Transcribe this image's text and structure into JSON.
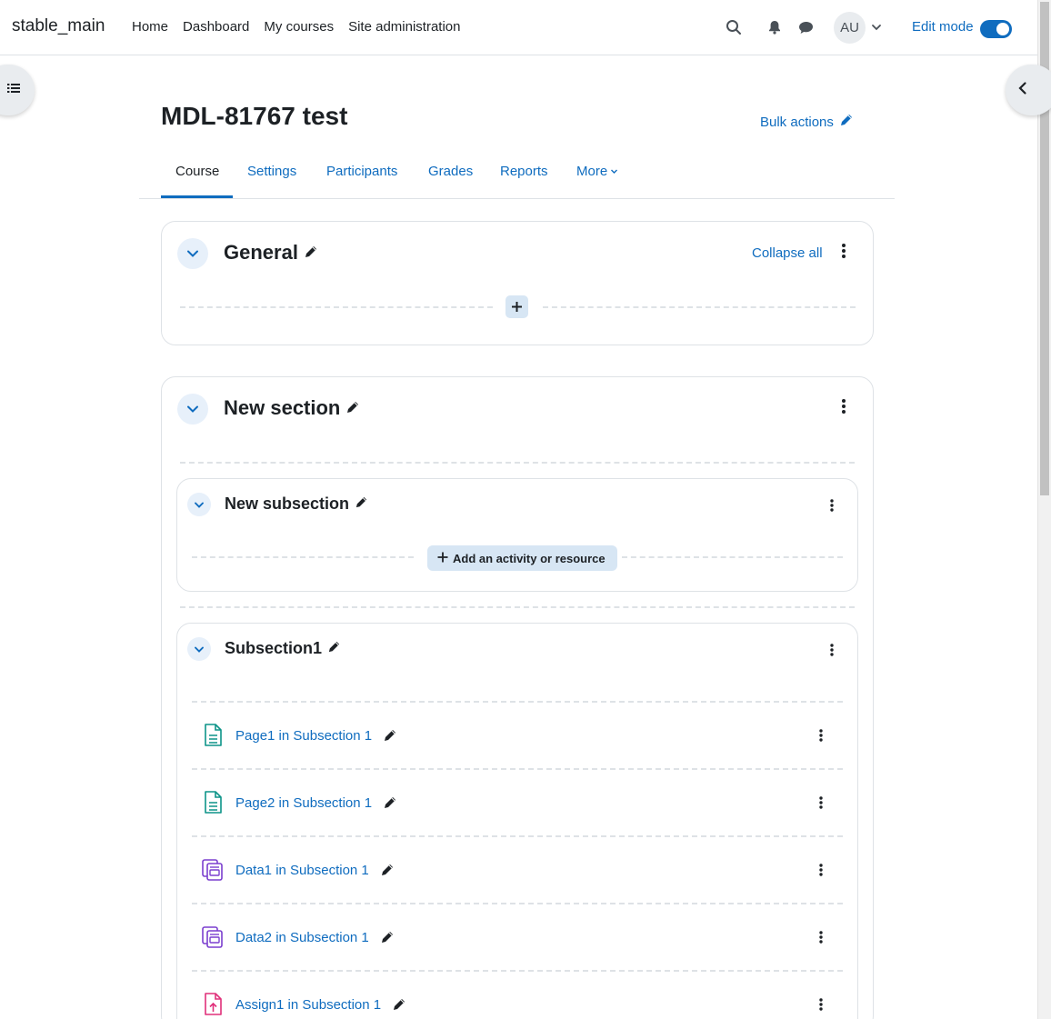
{
  "navbar": {
    "brand": "stable_main",
    "links": [
      "Home",
      "Dashboard",
      "My courses",
      "Site administration"
    ],
    "avatar_initials": "AU",
    "edit_mode_label": "Edit mode",
    "edit_mode_on": true
  },
  "header": {
    "title": "MDL-81767 test",
    "bulk_actions": "Bulk actions"
  },
  "tabs": [
    {
      "label": "Course",
      "active": true
    },
    {
      "label": "Settings"
    },
    {
      "label": "Participants"
    },
    {
      "label": "Grades"
    },
    {
      "label": "Reports"
    },
    {
      "label": "More"
    }
  ],
  "general": {
    "title": "General",
    "collapse_all": "Collapse all"
  },
  "new_section": {
    "title": "New section",
    "subsection_a": {
      "title": "New subsection",
      "add_label": "Add an activity or resource"
    },
    "subsection_b": {
      "title": "Subsection1",
      "activities": [
        {
          "name": "Page1 in Subsection 1",
          "icon": "page-icon"
        },
        {
          "name": "Page2 in Subsection 1",
          "icon": "page-icon"
        },
        {
          "name": "Data1 in Subsection 1",
          "icon": "database-icon"
        },
        {
          "name": "Data2 in Subsection 1",
          "icon": "database-icon"
        },
        {
          "name": "Assign1 in Subsection 1",
          "icon": "assignment-icon"
        }
      ]
    }
  },
  "colors": {
    "primary": "#0f6cbf",
    "page_icon": "#0d9488",
    "database_icon": "#7b3fcf",
    "assign_icon": "#e0307a"
  }
}
